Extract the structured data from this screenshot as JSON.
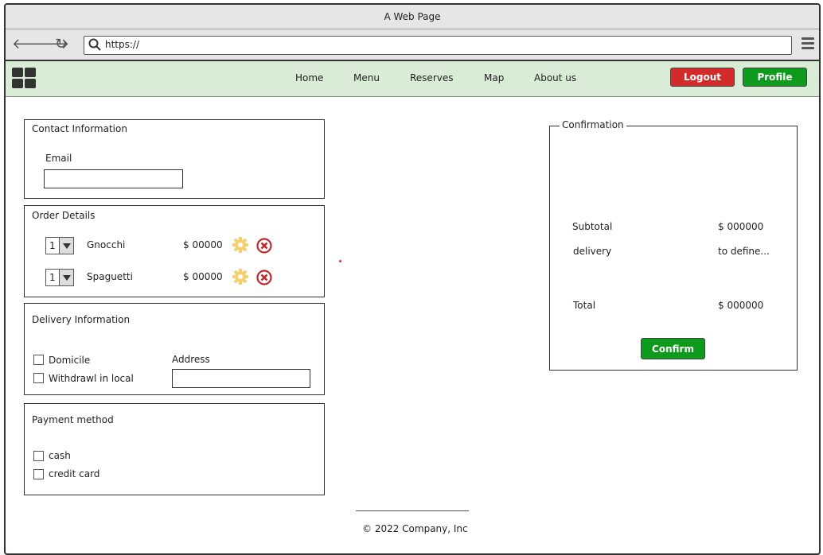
{
  "window": {
    "title": "A Web Page"
  },
  "browser": {
    "url": "https://"
  },
  "navbar": {
    "items": [
      "Home",
      "Menu",
      "Reserves",
      "Map",
      "About us"
    ],
    "logout_label": "Logout",
    "profile_label": "Profile"
  },
  "contact": {
    "title": "Contact Information",
    "email_label": "Email",
    "email_value": ""
  },
  "order": {
    "title": "Order Details",
    "items": [
      {
        "qty": "1",
        "name": "Gnocchi",
        "price": "$ 00000"
      },
      {
        "qty": "1",
        "name": "Spaguetti",
        "price": "$ 00000"
      }
    ]
  },
  "delivery": {
    "title": "Delivery Information",
    "options": [
      "Domicile",
      "Withdrawl in local"
    ],
    "address_label": "Address",
    "address_value": ""
  },
  "payment": {
    "title": "Payment method",
    "options": [
      "cash",
      "credit card"
    ]
  },
  "confirmation": {
    "legend": "Confirmation",
    "subtotal_label": "Subtotal",
    "subtotal_value": "$ 000000",
    "delivery_label": "delivery",
    "delivery_value": "to define...",
    "total_label": "Total",
    "total_value": "$ 000000",
    "confirm_label": "Confirm"
  },
  "footer": {
    "text": "© 2022 Company, Inc"
  },
  "colors": {
    "navbar_bg": "#d9ecd5",
    "logout": "#d22b2b",
    "profile": "#0e9a1d",
    "confirm": "#0e9a1d"
  }
}
